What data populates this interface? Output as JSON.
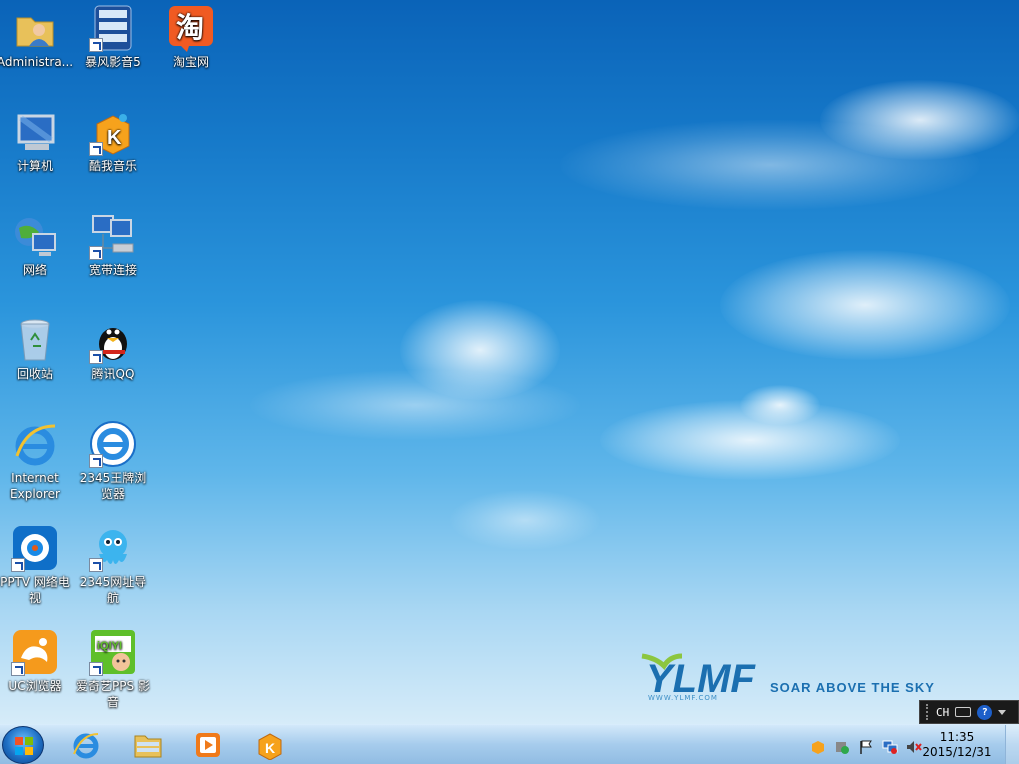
{
  "desktop": {
    "icons": [
      {
        "label": "Administra...",
        "icon": "user-folder-icon"
      },
      {
        "label": "暴风影音5",
        "icon": "media-player-icon"
      },
      {
        "label": "淘宝网",
        "icon": "taobao-icon"
      },
      {
        "label": "计算机",
        "icon": "computer-icon"
      },
      {
        "label": "酷我音乐",
        "icon": "kuwo-music-icon"
      },
      {
        "label": "网络",
        "icon": "network-icon"
      },
      {
        "label": "宽带连接",
        "icon": "broadband-icon"
      },
      {
        "label": "回收站",
        "icon": "recycle-bin-icon"
      },
      {
        "label": "腾讯QQ",
        "icon": "qq-icon"
      },
      {
        "label": "Internet Explorer",
        "icon": "ie-icon"
      },
      {
        "label": "2345王牌浏览器",
        "icon": "browser-2345-icon"
      },
      {
        "label": "PPTV 网络电视",
        "icon": "pptv-icon"
      },
      {
        "label": "2345网址导航",
        "icon": "octopus-icon"
      },
      {
        "label": "UC浏览器",
        "icon": "uc-browser-icon"
      },
      {
        "label": "爱奇艺PPS 影音",
        "icon": "iqiyi-icon"
      }
    ]
  },
  "wallpaper": {
    "logo": "YLMF",
    "tagline": "SOAR ABOVE THE SKY",
    "url": "WWW.YLMF.COM"
  },
  "language_bar": {
    "lang": "CH",
    "help": "?"
  },
  "taskbar": {
    "pinned": [
      "ie-icon",
      "explorer-folder-icon",
      "media-player-icon",
      "kuwo-icon"
    ],
    "clock_time": "11:35",
    "clock_date": "2015/12/31"
  },
  "colors": {
    "sky_top": "#0a63b8",
    "sky_bottom": "#e6f3fb",
    "logo_green": "#8cc63f",
    "logo_blue": "#1b6fb0"
  }
}
